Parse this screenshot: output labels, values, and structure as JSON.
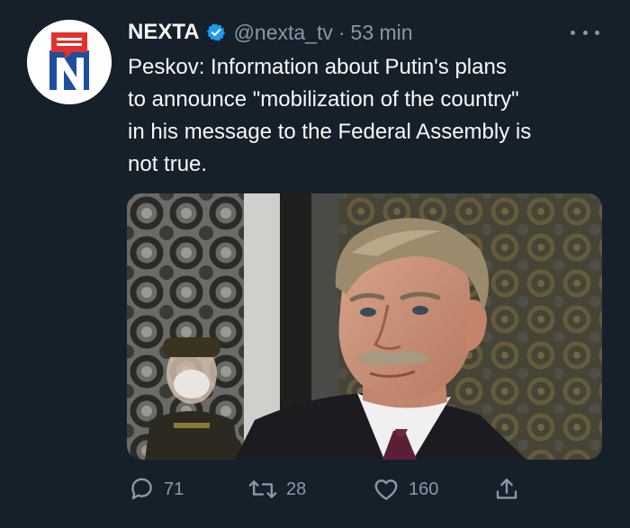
{
  "tweet": {
    "author_name": "NEXTA",
    "handle": "@nexta_tv",
    "separator": "·",
    "time": "53 min",
    "text_lines": [
      "Peskov: Information about Putin's plans",
      "to announce \"mobilization of the country\"",
      "in his message to the Federal Assembly is",
      "not true."
    ],
    "stats": {
      "replies": "71",
      "retweets": "28",
      "likes": "160"
    }
  },
  "colors": {
    "background": "#15202b",
    "text": "#f7f9f9",
    "muted": "#8b98a5",
    "verified": "#1d9bf0",
    "logo_red": "#e0322f",
    "logo_blue": "#1f4f9c"
  },
  "icons": {
    "verified": "verified-badge-icon",
    "more": "more-options-icon",
    "reply": "reply-icon",
    "retweet": "retweet-icon",
    "like": "like-icon",
    "share": "share-icon"
  }
}
